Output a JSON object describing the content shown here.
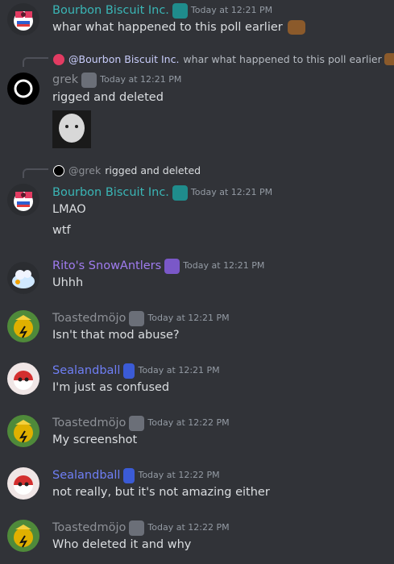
{
  "messages": [
    {
      "author": "Bourbon Biscuit Inc.",
      "time": "Today at 12:21 PM",
      "text": "whar what happened to this poll earlier"
    },
    {
      "reply": {
        "mention": "@Bourbon Biscuit Inc.",
        "text": "whar what happened to this poll earlier"
      },
      "author": "grek",
      "time": "Today at 12:21 PM",
      "text": "rigged and deleted"
    },
    {
      "reply": {
        "mention": "@grek",
        "text": "rigged and deleted"
      },
      "author": "Bourbon Biscuit Inc.",
      "time": "Today at 12:21 PM",
      "text": "LMAO",
      "text2": "wtf"
    },
    {
      "author": "Rito's SnowAntlers",
      "time": "Today at 12:21 PM",
      "text": "Uhhh"
    },
    {
      "author": "Toastedmöjo",
      "time": "Today at 12:21 PM",
      "text": "Isn't that mod abuse?"
    },
    {
      "author": "Sealandball",
      "time": "Today at 12:21 PM",
      "text": "I'm just as confused"
    },
    {
      "author": "Toastedmöjo",
      "time": "Today at 12:22 PM",
      "text": "My screenshot"
    },
    {
      "author": "Sealandball",
      "time": "Today at 12:22 PM",
      "text": "not really, but it's not amazing either"
    },
    {
      "author": "Toastedmöjo",
      "time": "Today at 12:22 PM",
      "text": "Who deleted it and why"
    }
  ],
  "colors": {
    "teal": "#3ab6b6",
    "purple": "#a07cf0",
    "blue": "#6f7ff5",
    "gray": "#8d9096"
  },
  "icons": {
    "bourbon": "bourbon-avatar",
    "grek": "grek-avatar",
    "rito": "rito-avatar",
    "toasted": "toastedmojo-avatar",
    "sealand": "sealandball-avatar",
    "emoji": "bear-emoji-icon"
  }
}
